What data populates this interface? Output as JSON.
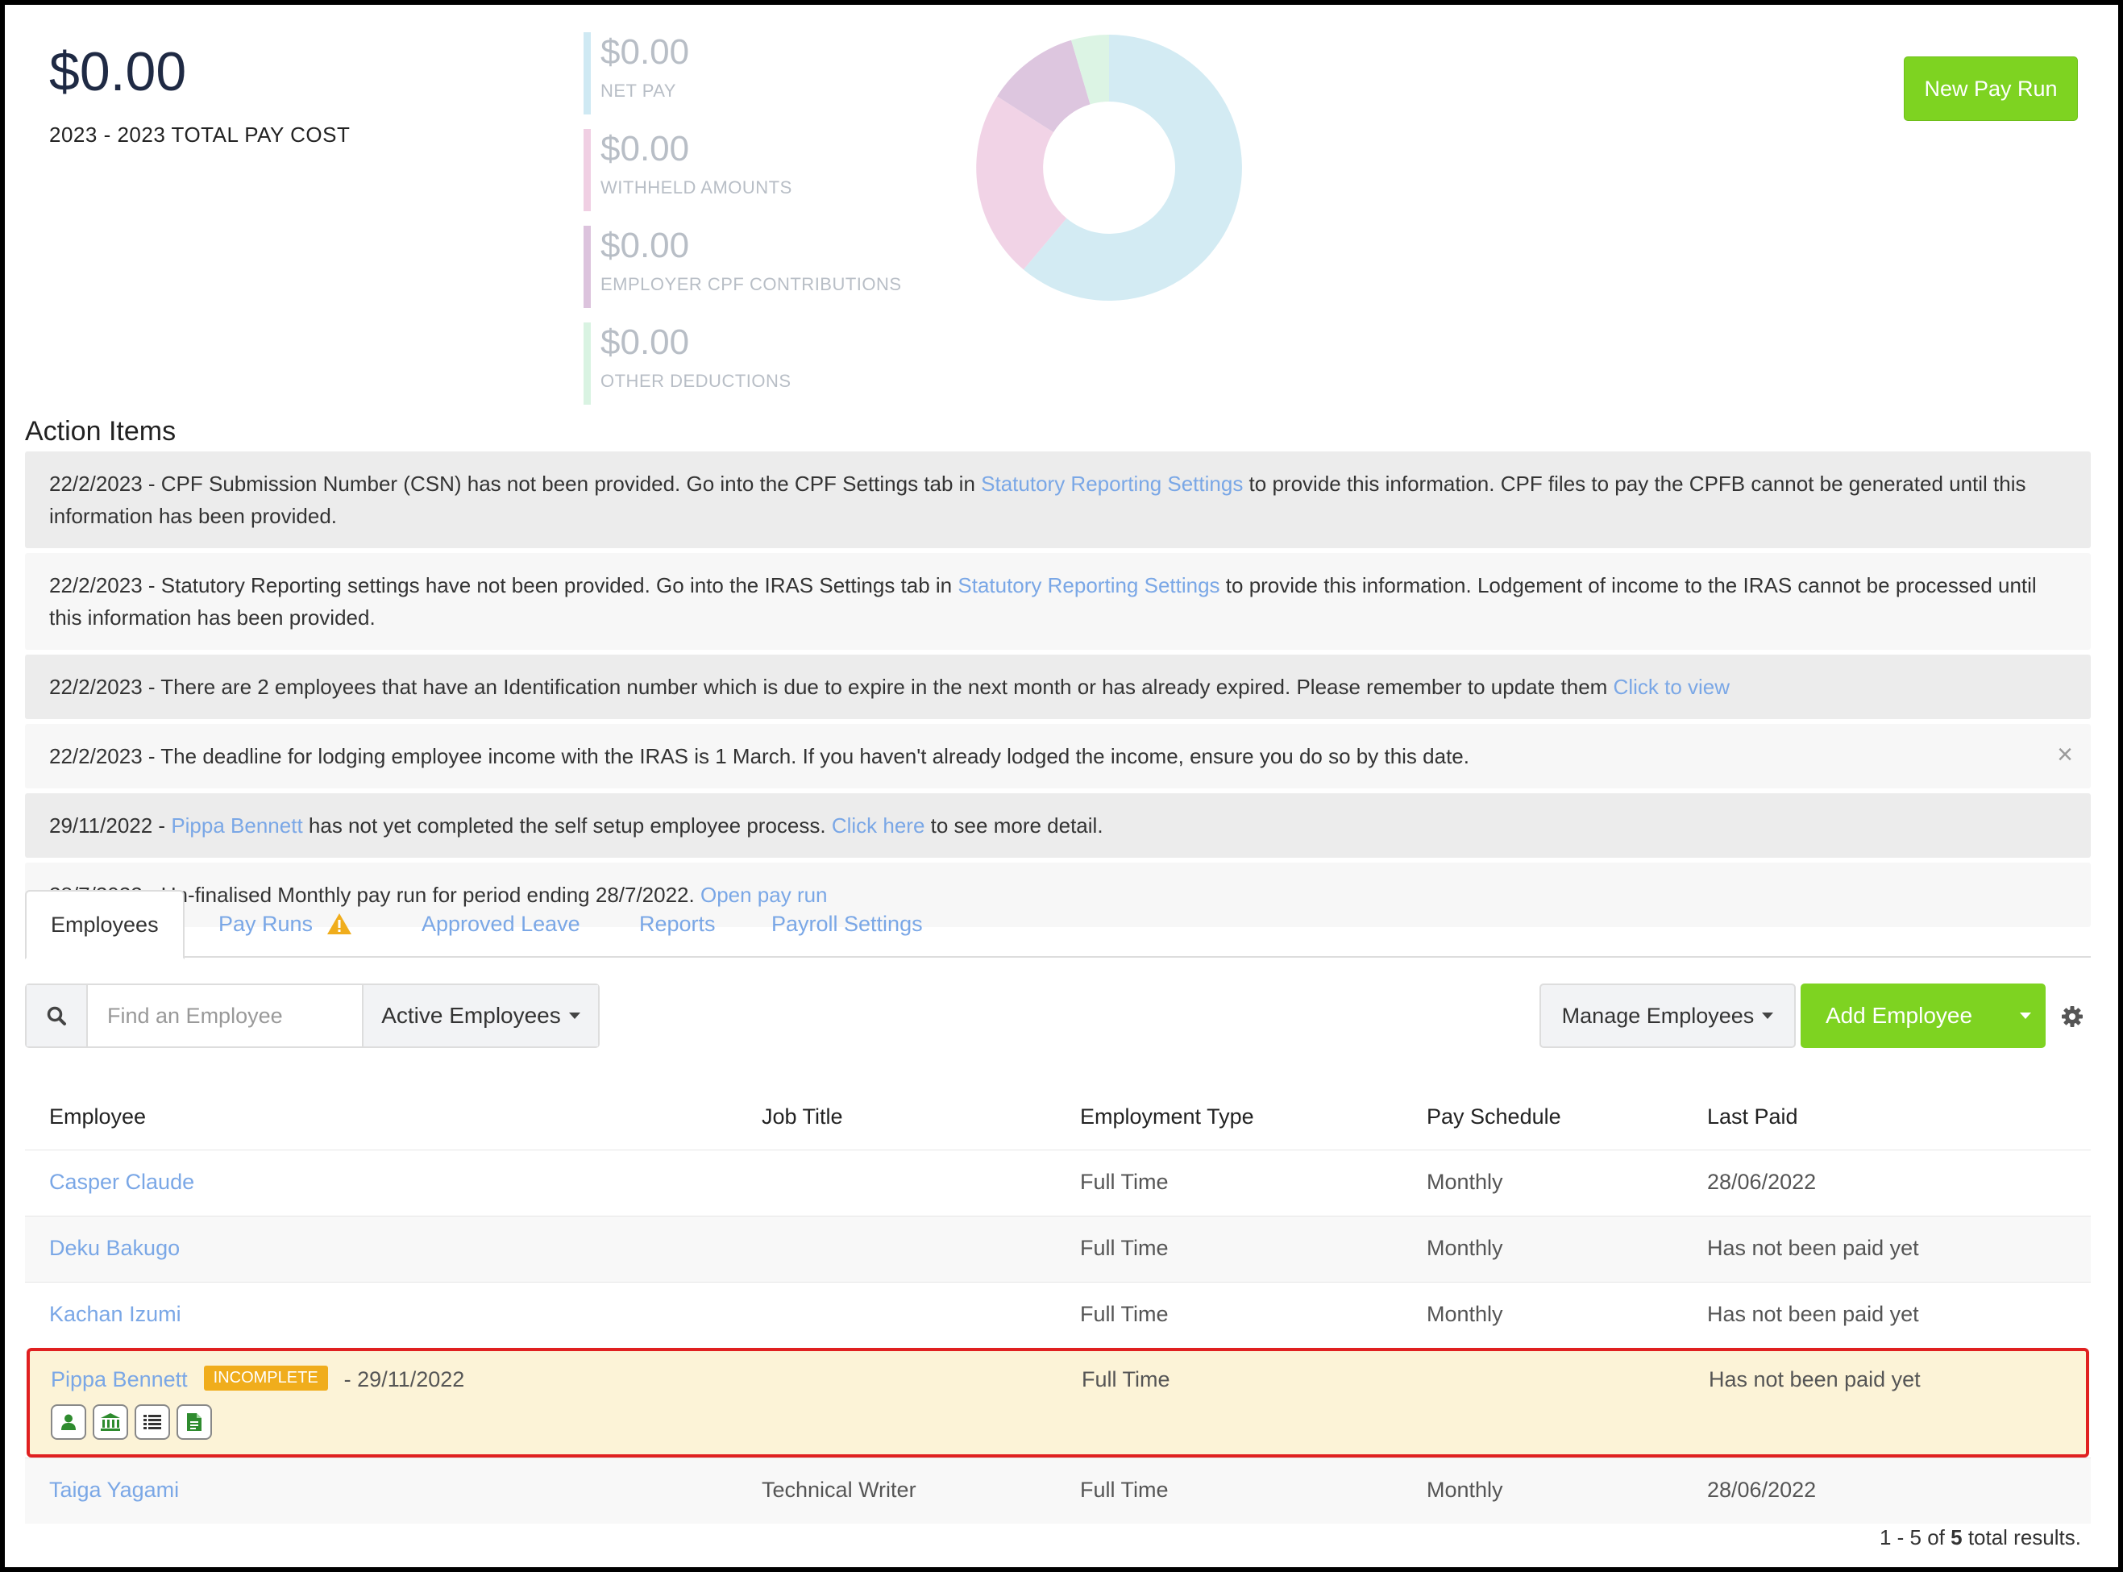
{
  "summary": {
    "total_amount": "$0.00",
    "total_label": "2023 - 2023 TOTAL PAY COST",
    "stats": [
      {
        "amount": "$0.00",
        "label": "NET PAY",
        "color": "#cfe9f3"
      },
      {
        "amount": "$0.00",
        "label": "WITHHELD AMOUNTS",
        "color": "#f0cfe3"
      },
      {
        "amount": "$0.00",
        "label": "EMPLOYER CPF CONTRIBUTIONS",
        "color": "#dcc3dd"
      },
      {
        "amount": "$0.00",
        "label": "OTHER DEDUCTIONS",
        "color": "#d9f3e2"
      }
    ],
    "new_pay_run_label": "New Pay Run",
    "accent_color": "#7ed321"
  },
  "action_items": {
    "title": "Action Items",
    "items": [
      {
        "pre": "22/2/2023 - CPF Submission Number (CSN) has not been provided. Go into the CPF Settings tab in ",
        "link": "Statutory Reporting Settings",
        "post": " to provide this information. CPF files to pay the CPFB cannot be generated until this information has been provided."
      },
      {
        "pre": "22/2/2023 - Statutory Reporting settings have not been provided. Go into the IRAS Settings tab in ",
        "link": "Statutory Reporting Settings",
        "post": " to provide this information. Lodgement of income to the IRAS cannot be processed until this information has been provided."
      },
      {
        "pre": "22/2/2023 - There are 2 employees that have an Identification number which is due to expire in the next month or has already expired. Please remember to update them ",
        "link": "Click to view",
        "post": ""
      },
      {
        "pre": "22/2/2023 - The deadline for lodging employee income with the IRAS is 1 March. If you haven't already lodged the income, ensure you do so by this date.",
        "link": "",
        "post": "",
        "close": "×"
      },
      {
        "pre": "29/11/2022 - ",
        "link": "Pippa Bennett",
        "post": " has not yet completed the self setup employee process. ",
        "link2": "Click here",
        "post2": " to see more detail."
      },
      {
        "pre": "28/7/2022 - Un-finalised Monthly pay run for period ending 28/7/2022. ",
        "link": "Open pay run",
        "post": ""
      }
    ]
  },
  "tabs": {
    "employees": "Employees",
    "pay_runs": "Pay Runs",
    "approved_leave": "Approved Leave",
    "reports": "Reports",
    "payroll_settings": "Payroll Settings"
  },
  "toolbar": {
    "search_placeholder": "Find an Employee",
    "filter_label": "Active Employees",
    "manage_label": "Manage Employees",
    "add_label": "Add Employee"
  },
  "table": {
    "headers": {
      "employee": "Employee",
      "job_title": "Job Title",
      "employment_type": "Employment Type",
      "pay_schedule": "Pay Schedule",
      "last_paid": "Last Paid"
    },
    "rows": [
      {
        "name": "Casper Claude",
        "job": "",
        "type": "Full Time",
        "schedule": "Monthly",
        "last_paid": "28/06/2022"
      },
      {
        "name": "Deku Bakugo",
        "job": "",
        "type": "Full Time",
        "schedule": "Monthly",
        "last_paid": "Has not been paid yet"
      },
      {
        "name": "Kachan Izumi",
        "job": "",
        "type": "Full Time",
        "schedule": "Monthly",
        "last_paid": "Has not been paid yet"
      },
      {
        "name": "Pippa Bennett",
        "badge": "INCOMPLETE",
        "date": "- 29/11/2022",
        "job": "",
        "type": "Full Time",
        "schedule": "",
        "last_paid": "Has not been paid yet"
      },
      {
        "name": "Taiga Yagami",
        "job": "Technical Writer",
        "type": "Full Time",
        "schedule": "Monthly",
        "last_paid": "28/06/2022"
      }
    ]
  },
  "pagination": {
    "range": "1 - 5 of ",
    "total": "5",
    "suffix": " total results."
  }
}
